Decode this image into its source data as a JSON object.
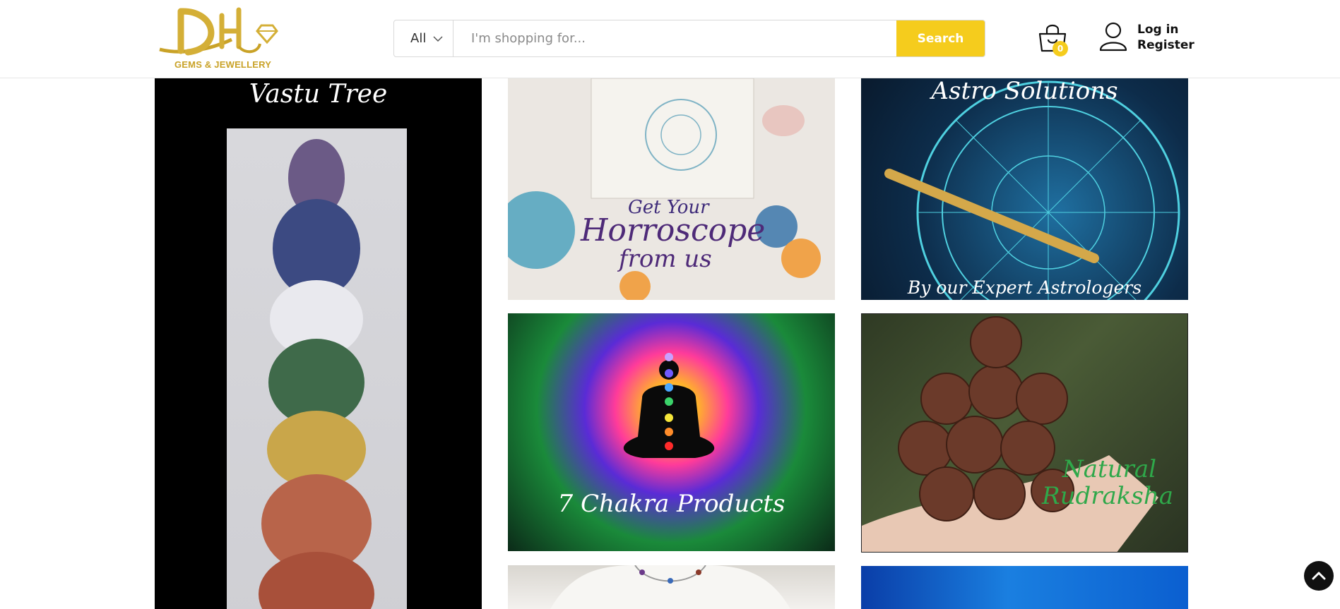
{
  "brand": {
    "logo_subtitle": "GEMS & JEWELLERY",
    "logo_color": "#c9a227"
  },
  "search": {
    "category_value": "All",
    "placeholder": "I'm shopping for...",
    "value": "",
    "button_label": "Search",
    "button_color": "#f5cc1d"
  },
  "cart": {
    "count": "0"
  },
  "account": {
    "login_label": "Log in",
    "register_label": "Register"
  },
  "banners": [
    {
      "id": "vastu",
      "text": "Vastu Tree"
    },
    {
      "id": "horoscope",
      "lines": [
        "Get Your",
        "Horroscope",
        "from us"
      ]
    },
    {
      "id": "astro",
      "title": "Astro Solutions",
      "subtitle": "By our Expert Astrologers"
    },
    {
      "id": "chakra",
      "text": "7 Chakra Products"
    },
    {
      "id": "rudraksha",
      "lines": [
        "Natural",
        "Rudraksha"
      ]
    }
  ],
  "icons": {
    "cart": "shopping-bag-icon",
    "account": "user-icon",
    "category_dropdown": "chevron-down-icon",
    "back_to_top": "chevron-up-icon"
  }
}
